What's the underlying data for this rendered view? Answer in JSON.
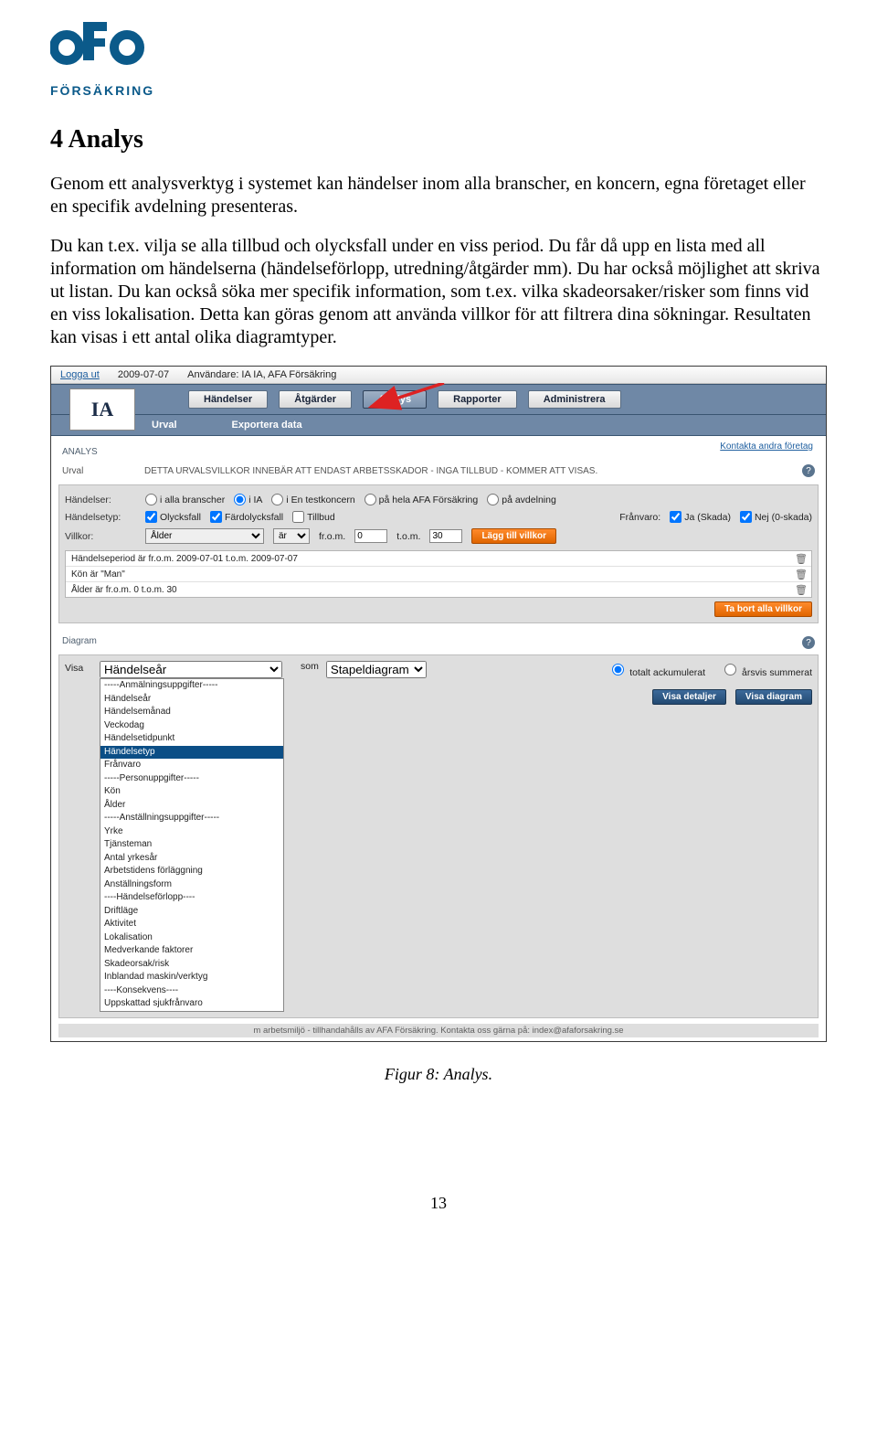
{
  "logo": {
    "sub": "FÖRSÄKRING"
  },
  "section_title": "4 Analys",
  "para1": "Genom ett analysverktyg i systemet kan händelser inom alla branscher, en koncern, egna företaget eller en specifik avdelning presenteras.",
  "para2": "Du kan t.ex. vilja se alla tillbud och olycksfall under en viss period. Du får då upp en lista med all information om händelserna (händelseförlopp, utredning/åtgärder mm). Du har också möjlighet att skriva ut listan. Du kan också söka mer specifik information, som t.ex. vilka skadeorsaker/risker som finns vid en viss lokalisation. Detta kan göras genom att använda villkor för att filtrera dina sökningar. Resultaten kan visas i ett antal olika diagramtyper.",
  "topbar": {
    "logout": "Logga ut",
    "date": "2009-07-07",
    "user": "Användare: IA IA, AFA Försäkring"
  },
  "ia_logo": "IA",
  "tabs": {
    "handelser": "Händelser",
    "atgarder": "Åtgärder",
    "analys": "Analys",
    "rapporter": "Rapporter",
    "administrera": "Administrera"
  },
  "subtabs": {
    "urval": "Urval",
    "exportera": "Exportera data"
  },
  "block": {
    "title": "ANALYS",
    "kontakta": "Kontakta andra företag",
    "urval_label": "Urval",
    "urval_note": "DETTA URVALSVILLKOR INNEBÄR ATT ENDAST ARBETSSKADOR - INGA TILLBUD - KOMMER ATT VISAS."
  },
  "filters": {
    "handelser_label": "Händelser:",
    "scope": {
      "alla": "i alla branscher",
      "ia": "i IA",
      "test": "i En testkoncern",
      "hela": "på hela AFA Försäkring",
      "avd": "på avdelning"
    },
    "handelsetyp_label": "Händelsetyp:",
    "type_olycksfall": "Olycksfall",
    "type_fardolycksfall": "Färdolycksfall",
    "type_tillbud": "Tillbud",
    "franvaro_label": "Frånvaro:",
    "franvaro_ja": "Ja (Skada)",
    "franvaro_nej": "Nej (0-skada)",
    "villkor_label": "Villkor:",
    "villkor_select": "Ålder",
    "op_select": "är",
    "from_label": "fr.o.m.",
    "from_value": "0",
    "tom_label": "t.o.m.",
    "tom_value": "30",
    "add_btn": "Lägg till villkor",
    "list": [
      "Händelseperiod är fr.o.m. 2009-07-01 t.o.m. 2009-07-07",
      "Kön är \"Man\"",
      "Ålder är fr.o.m. 0 t.o.m. 30"
    ],
    "remove_all_btn": "Ta bort alla villkor"
  },
  "diagram": {
    "section_label": "Diagram",
    "visa_label": "Visa",
    "visa_selected": "Händelseår",
    "som_label": "som",
    "som_select": "Stapeldiagram",
    "ack": "totalt ackumulerat",
    "arsvis": "årsvis summerat",
    "btn_detaljer": "Visa detaljer",
    "btn_diagram": "Visa diagram",
    "options": [
      {
        "text": "-----Anmälningsuppgifter-----",
        "selected": false
      },
      {
        "text": "Händelseår",
        "selected": false
      },
      {
        "text": "Händelsemånad",
        "selected": false
      },
      {
        "text": "Veckodag",
        "selected": false
      },
      {
        "text": "Händelsetidpunkt",
        "selected": false
      },
      {
        "text": "Händelsetyp",
        "selected": true
      },
      {
        "text": "Frånvaro",
        "selected": false
      },
      {
        "text": "-----Personuppgifter-----",
        "selected": false
      },
      {
        "text": "Kön",
        "selected": false
      },
      {
        "text": "Ålder",
        "selected": false
      },
      {
        "text": "-----Anställningsuppgifter-----",
        "selected": false
      },
      {
        "text": "Yrke",
        "selected": false
      },
      {
        "text": "Tjänsteman",
        "selected": false
      },
      {
        "text": "Antal yrkesår",
        "selected": false
      },
      {
        "text": "Arbetstidens förläggning",
        "selected": false
      },
      {
        "text": "Anställningsform",
        "selected": false
      },
      {
        "text": "----Händelseförlopp----",
        "selected": false
      },
      {
        "text": "Driftläge",
        "selected": false
      },
      {
        "text": "Aktivitet",
        "selected": false
      },
      {
        "text": "Lokalisation",
        "selected": false
      },
      {
        "text": "Medverkande faktorer",
        "selected": false
      },
      {
        "text": "Skadeorsak/risk",
        "selected": false
      },
      {
        "text": "Inblandad maskin/verktyg",
        "selected": false
      },
      {
        "text": "----Konsekvens----",
        "selected": false
      },
      {
        "text": "Uppskattad sjukfrånvaro",
        "selected": false
      }
    ]
  },
  "footer_text": "m arbetsmiljö - tillhandahålls av AFA Försäkring. Kontakta oss gärna på: index@afaforsakring.se",
  "caption": "Figur 8: Analys.",
  "page_number": "13"
}
